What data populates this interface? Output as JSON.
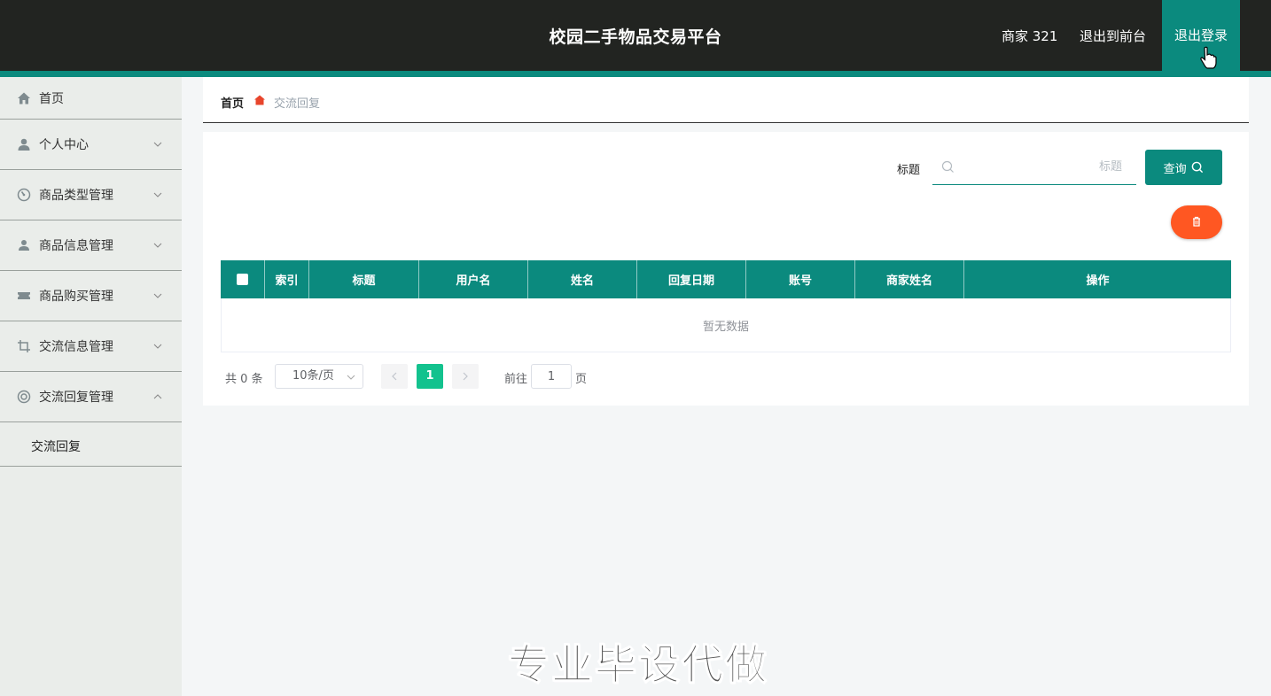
{
  "header": {
    "title": "校园二手物品交易平台",
    "user": "商家 321",
    "front_link": "退出到前台",
    "logout": "退出登录"
  },
  "sidebar": {
    "items": [
      {
        "label": "首页",
        "icon": "home-icon",
        "has_arrow": false
      },
      {
        "label": "个人中心",
        "icon": "user-icon",
        "has_arrow": true,
        "expanded": false
      },
      {
        "label": "商品类型管理",
        "icon": "dashboard-icon",
        "has_arrow": true,
        "expanded": false
      },
      {
        "label": "商品信息管理",
        "icon": "person-icon",
        "has_arrow": true,
        "expanded": false
      },
      {
        "label": "商品购买管理",
        "icon": "ticket-icon",
        "has_arrow": true,
        "expanded": false
      },
      {
        "label": "交流信息管理",
        "icon": "crop-icon",
        "has_arrow": true,
        "expanded": false
      },
      {
        "label": "交流回复管理",
        "icon": "lifebuoy-icon",
        "has_arrow": true,
        "expanded": true
      }
    ],
    "submenu": [
      {
        "label": "交流回复"
      }
    ]
  },
  "breadcrumb": {
    "home": "首页",
    "current": "交流回复"
  },
  "search": {
    "label": "标题",
    "placeholder": "标题",
    "value": "",
    "button_label": "查询"
  },
  "table": {
    "columns": [
      "索引",
      "标题",
      "用户名",
      "姓名",
      "回复日期",
      "账号",
      "商家姓名",
      "操作"
    ],
    "rows": [],
    "empty_text": "暂无数据"
  },
  "pagination": {
    "total_text": "共 0 条",
    "page_size": "10条/页",
    "current_page": "1",
    "goto_label": "前往",
    "goto_value": "1",
    "page_suffix": "页"
  },
  "watermark": "专业毕设代做",
  "colors": {
    "header_bg": "#222421",
    "accent": "#0b8a7e",
    "danger": "#ff5722",
    "active_page": "#13c28e",
    "sidebar_bg": "#eaedea"
  }
}
